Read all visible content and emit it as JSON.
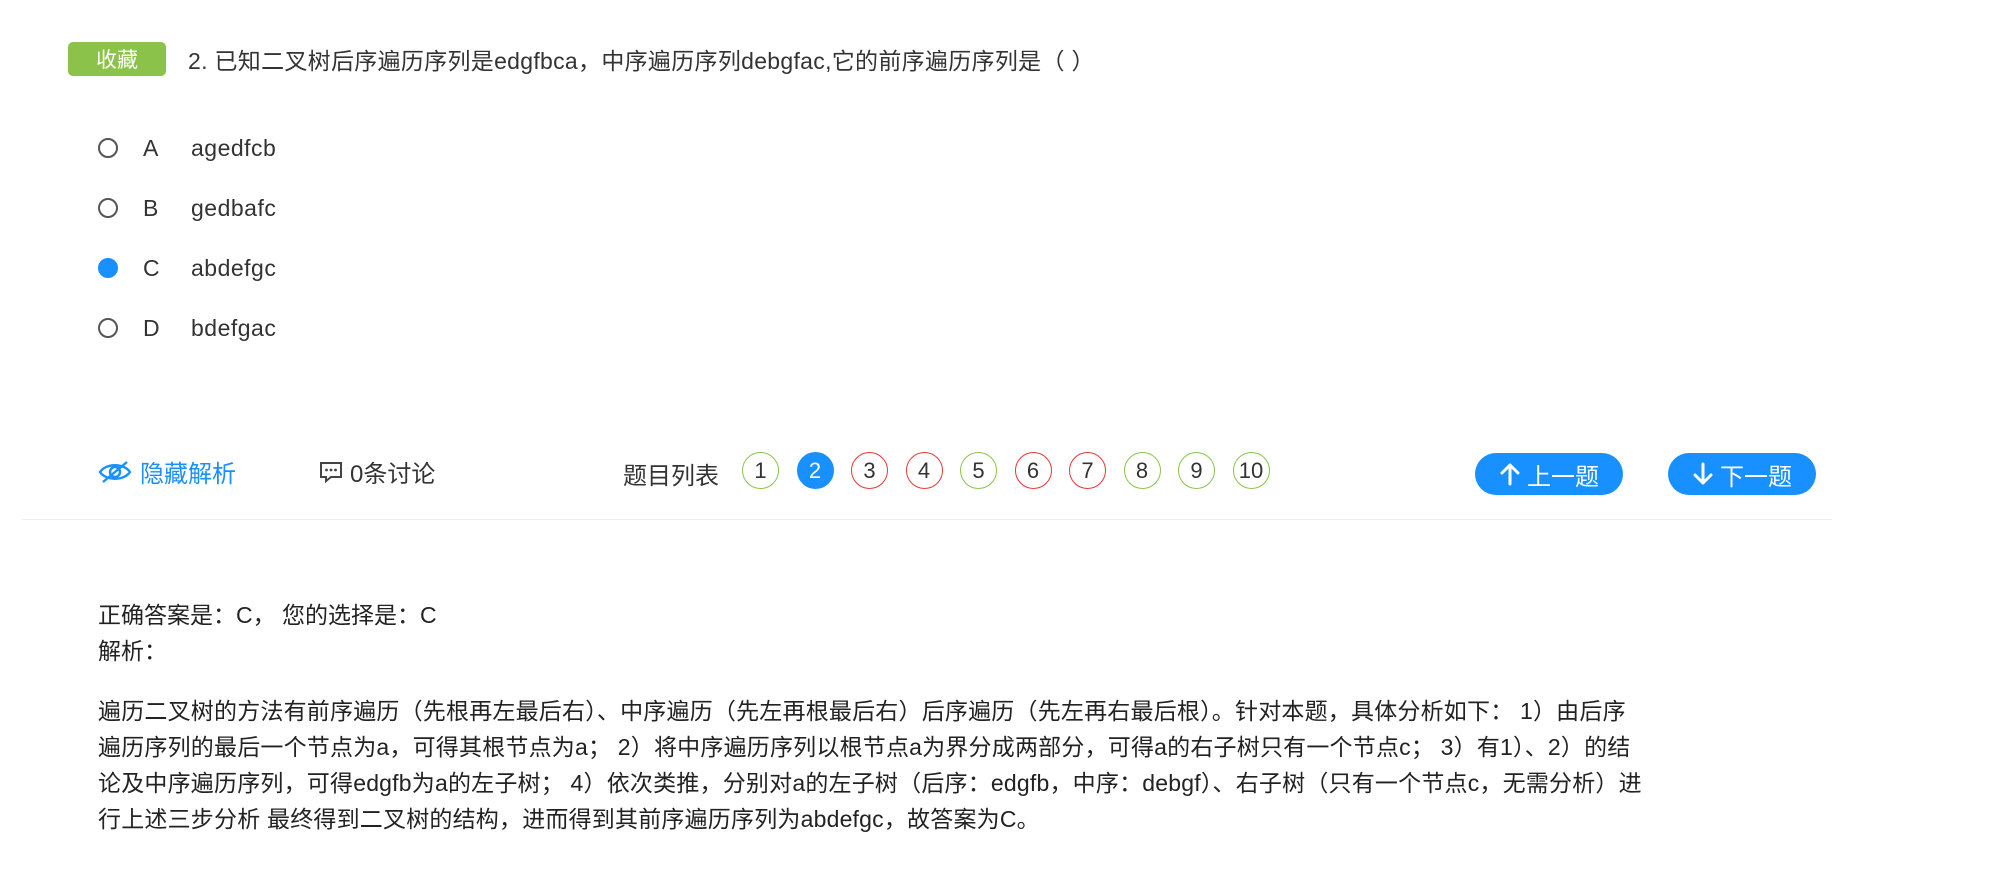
{
  "question": {
    "favorite_label": "收藏",
    "text": "2. 已知二叉树后序遍历序列是edgfbca，中序遍历序列debgfac,它的前序遍历序列是（ ）",
    "options": [
      {
        "letter": "A",
        "text": "agedfcb",
        "selected": false
      },
      {
        "letter": "B",
        "text": "gedbafc",
        "selected": false
      },
      {
        "letter": "C",
        "text": "abdefgc",
        "selected": true
      },
      {
        "letter": "D",
        "text": "bdefgac",
        "selected": false
      }
    ]
  },
  "toolbar": {
    "hide_analysis_label": "隐藏解析",
    "discussion_label": "0条讨论",
    "question_list_label": "题目列表",
    "question_numbers": [
      {
        "num": "1",
        "status": "correct"
      },
      {
        "num": "2",
        "status": "current"
      },
      {
        "num": "3",
        "status": "wrong"
      },
      {
        "num": "4",
        "status": "wrong"
      },
      {
        "num": "5",
        "status": "correct"
      },
      {
        "num": "6",
        "status": "wrong"
      },
      {
        "num": "7",
        "status": "wrong"
      },
      {
        "num": "8",
        "status": "correct"
      },
      {
        "num": "9",
        "status": "correct"
      },
      {
        "num": "10",
        "status": "correct"
      }
    ],
    "prev_label": "上一题",
    "next_label": "下一题"
  },
  "answer": {
    "result_line": "正确答案是：C， 您的选择是：C",
    "analysis_label": "解析：",
    "analysis_lines": [
      "遍历二叉树的方法有前序遍历（先根再左最后右）、中序遍历（先左再根最后右）后序遍历（先左再右最后根）。针对本题，具体分析如下： 1）由后序",
      "遍历序列的最后一个节点为a，可得其根节点为a； 2）将中序遍历序列以根节点a为界分成两部分，可得a的右子树只有一个节点c； 3）有1）、2）的结",
      "论及中序遍历序列，可得edgfb为a的左子树； 4）依次类推，分别对a的左子树（后序：edgfb，中序：debgf）、右子树（只有一个节点c，无需分析）进",
      "行上述三步分析 最终得到二叉树的结构，进而得到其前序遍历序列为abdefgc，故答案为C。"
    ]
  },
  "colors": {
    "accent": "#1890ff",
    "favorite": "#8bc34a",
    "correct": "#8bc34a",
    "wrong": "#e53935"
  },
  "icons": {
    "hide_analysis": "eye-icon",
    "discussion": "comment-icon",
    "prev": "arrow-up-icon",
    "next": "arrow-down-icon"
  }
}
